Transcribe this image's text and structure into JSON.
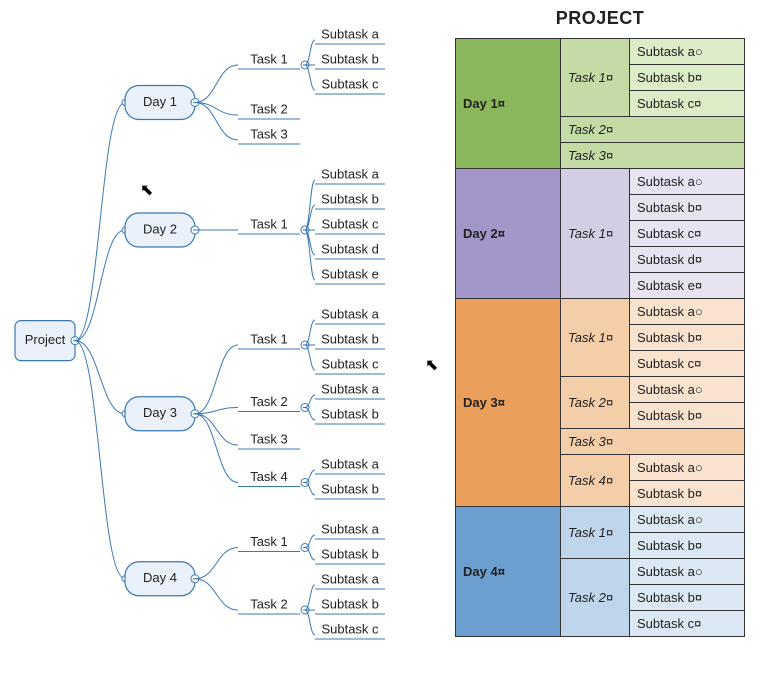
{
  "mindmap": {
    "root": "Project",
    "days": [
      {
        "label": "Day 1",
        "tasks": [
          {
            "label": "Task 1",
            "subtasks": [
              "Subtask a",
              "Subtask b",
              "Subtask c"
            ]
          },
          {
            "label": "Task 2",
            "subtasks": []
          },
          {
            "label": "Task 3",
            "subtasks": []
          }
        ]
      },
      {
        "label": "Day 2",
        "tasks": [
          {
            "label": "Task 1",
            "subtasks": [
              "Subtask a",
              "Subtask b",
              "Subtask c",
              "Subtask d",
              "Subtask e"
            ]
          }
        ]
      },
      {
        "label": "Day 3",
        "tasks": [
          {
            "label": "Task 1",
            "subtasks": [
              "Subtask a",
              "Subtask b",
              "Subtask c"
            ]
          },
          {
            "label": "Task 2",
            "subtasks": [
              "Subtask a",
              "Subtask b"
            ]
          },
          {
            "label": "Task 3",
            "subtasks": []
          },
          {
            "label": "Task 4",
            "subtasks": [
              "Subtask a",
              "Subtask b"
            ]
          }
        ]
      },
      {
        "label": "Day 4",
        "tasks": [
          {
            "label": "Task 1",
            "subtasks": [
              "Subtask a",
              "Subtask b"
            ]
          },
          {
            "label": "Task 2",
            "subtasks": [
              "Subtask a",
              "Subtask b",
              "Subtask c"
            ]
          }
        ]
      }
    ]
  },
  "table": {
    "title": "PROJECT",
    "end_mark": "¤",
    "sub_a_mark": "○",
    "groups": [
      {
        "label": "Day 1",
        "color": "grn",
        "tasks": [
          {
            "label": "Task 1",
            "subtasks": [
              "Subtask a",
              "Subtask b",
              "Subtask c"
            ]
          },
          {
            "label": "Task 2",
            "subtasks": []
          },
          {
            "label": "Task 3",
            "subtasks": []
          }
        ]
      },
      {
        "label": "Day 2",
        "color": "pur",
        "tasks": [
          {
            "label": "Task 1",
            "subtasks": [
              "Subtask a",
              "Subtask b",
              "Subtask c",
              "Subtask d",
              "Subtask e"
            ]
          }
        ]
      },
      {
        "label": "Day 3",
        "color": "org",
        "tasks": [
          {
            "label": "Task 1",
            "subtasks": [
              "Subtask a",
              "Subtask b",
              "Subtask c"
            ]
          },
          {
            "label": "Task 2",
            "subtasks": [
              "Subtask a",
              "Subtask b"
            ]
          },
          {
            "label": "Task 3",
            "subtasks": []
          },
          {
            "label": "Task 4",
            "subtasks": [
              "Subtask a",
              "Subtask b"
            ]
          }
        ]
      },
      {
        "label": "Day 4",
        "color": "blu",
        "tasks": [
          {
            "label": "Task 1",
            "subtasks": [
              "Subtask a",
              "Subtask b"
            ]
          },
          {
            "label": "Task 2",
            "subtasks": [
              "Subtask a",
              "Subtask b",
              "Subtask c"
            ]
          }
        ]
      }
    ]
  },
  "cursors": {
    "left": "↖",
    "right": "↖"
  },
  "chart_data": {
    "type": "tree",
    "title": "Project",
    "root": "Project",
    "children": [
      {
        "name": "Day 1",
        "children": [
          {
            "name": "Task 1",
            "children": [
              "Subtask a",
              "Subtask b",
              "Subtask c"
            ]
          },
          {
            "name": "Task 2",
            "children": []
          },
          {
            "name": "Task 3",
            "children": []
          }
        ]
      },
      {
        "name": "Day 2",
        "children": [
          {
            "name": "Task 1",
            "children": [
              "Subtask a",
              "Subtask b",
              "Subtask c",
              "Subtask d",
              "Subtask e"
            ]
          }
        ]
      },
      {
        "name": "Day 3",
        "children": [
          {
            "name": "Task 1",
            "children": [
              "Subtask a",
              "Subtask b",
              "Subtask c"
            ]
          },
          {
            "name": "Task 2",
            "children": [
              "Subtask a",
              "Subtask b"
            ]
          },
          {
            "name": "Task 3",
            "children": []
          },
          {
            "name": "Task 4",
            "children": [
              "Subtask a",
              "Subtask b"
            ]
          }
        ]
      },
      {
        "name": "Day 4",
        "children": [
          {
            "name": "Task 1",
            "children": [
              "Subtask a",
              "Subtask b"
            ]
          },
          {
            "name": "Task 2",
            "children": [
              "Subtask a",
              "Subtask b",
              "Subtask c"
            ]
          }
        ]
      }
    ]
  }
}
